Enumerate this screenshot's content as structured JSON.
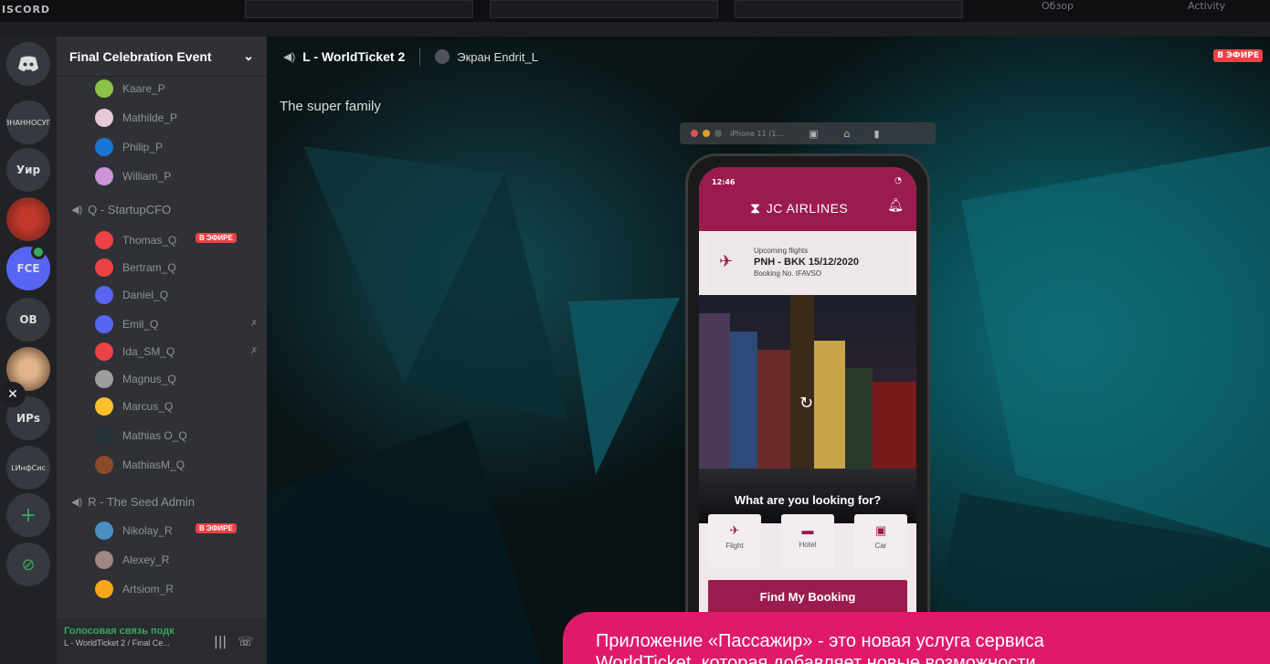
{
  "app": {
    "brand": "ISCORD"
  },
  "top_strip": {
    "ghost_labels": [
      "Обзор",
      "Activity"
    ]
  },
  "guilds": [
    {
      "label": "",
      "icon": "discord-home-icon"
    },
    {
      "label": "ЗНАННОСУП"
    },
    {
      "label": "Уир"
    },
    {
      "label": ""
    },
    {
      "label": "FCE"
    },
    {
      "label": "OB"
    },
    {
      "label": ""
    },
    {
      "label": "ИРs"
    },
    {
      "label": "LИнфСис"
    },
    {
      "label": "+",
      "icon": "add-server-icon"
    },
    {
      "label": "⊘",
      "icon": "explore-icon"
    }
  ],
  "server": {
    "name": "Final Celebration Event",
    "chevron": "⌄"
  },
  "members_top": [
    "Kaare_P",
    "Mathilde_P",
    "Philip_P",
    "William_P"
  ],
  "channel_q": {
    "name": "Q - StartupCFO"
  },
  "members_q": [
    "Thomas_Q",
    "Bertram_Q",
    "Daniel_Q",
    "Emil_Q",
    "Ida_SM_Q",
    "Magnus_Q",
    "Marcus_Q",
    "Mathias O_Q",
    "MathiasM_Q"
  ],
  "channel_r": {
    "name": "R - The Seed Admin"
  },
  "members_r": [
    "Nikolay_R",
    "Alexey_R",
    "Artsiom_R"
  ],
  "live_badge": "В ЭФИРЕ",
  "voice_panel": {
    "status": "Голосовая связь подк",
    "sub": "L - WorldTicket 2 / Final Ce..."
  },
  "stage": {
    "voice_channel": "L - WorldTicket 2",
    "screen_label": "Экран Endrit_L",
    "live": "В ЭФИРЕ",
    "caption": "The super family"
  },
  "phone": {
    "simulator_title": "iPhone 11 (1...",
    "time": "12:46",
    "airline": "JC AIRLINES",
    "upcoming_label": "Upcoming flights",
    "route": "PNH - BKK 15/12/2020",
    "booking": "Booking No. IFAVSO",
    "question": "What are you looking for?",
    "options": [
      "Flight",
      "Hotel",
      "Car"
    ],
    "find_button": "Find My Booking",
    "pager": "● • •"
  },
  "promo": {
    "text": "Приложение «Пассажир» - это новая услуга сервиса",
    "text2": "WorldTicket, которая добавляет новые возможности"
  },
  "colors": {
    "live": "#ed4245",
    "brand": "#9b1b4f",
    "promo": "#e01a6b",
    "voice_ok": "#3ba55d"
  }
}
